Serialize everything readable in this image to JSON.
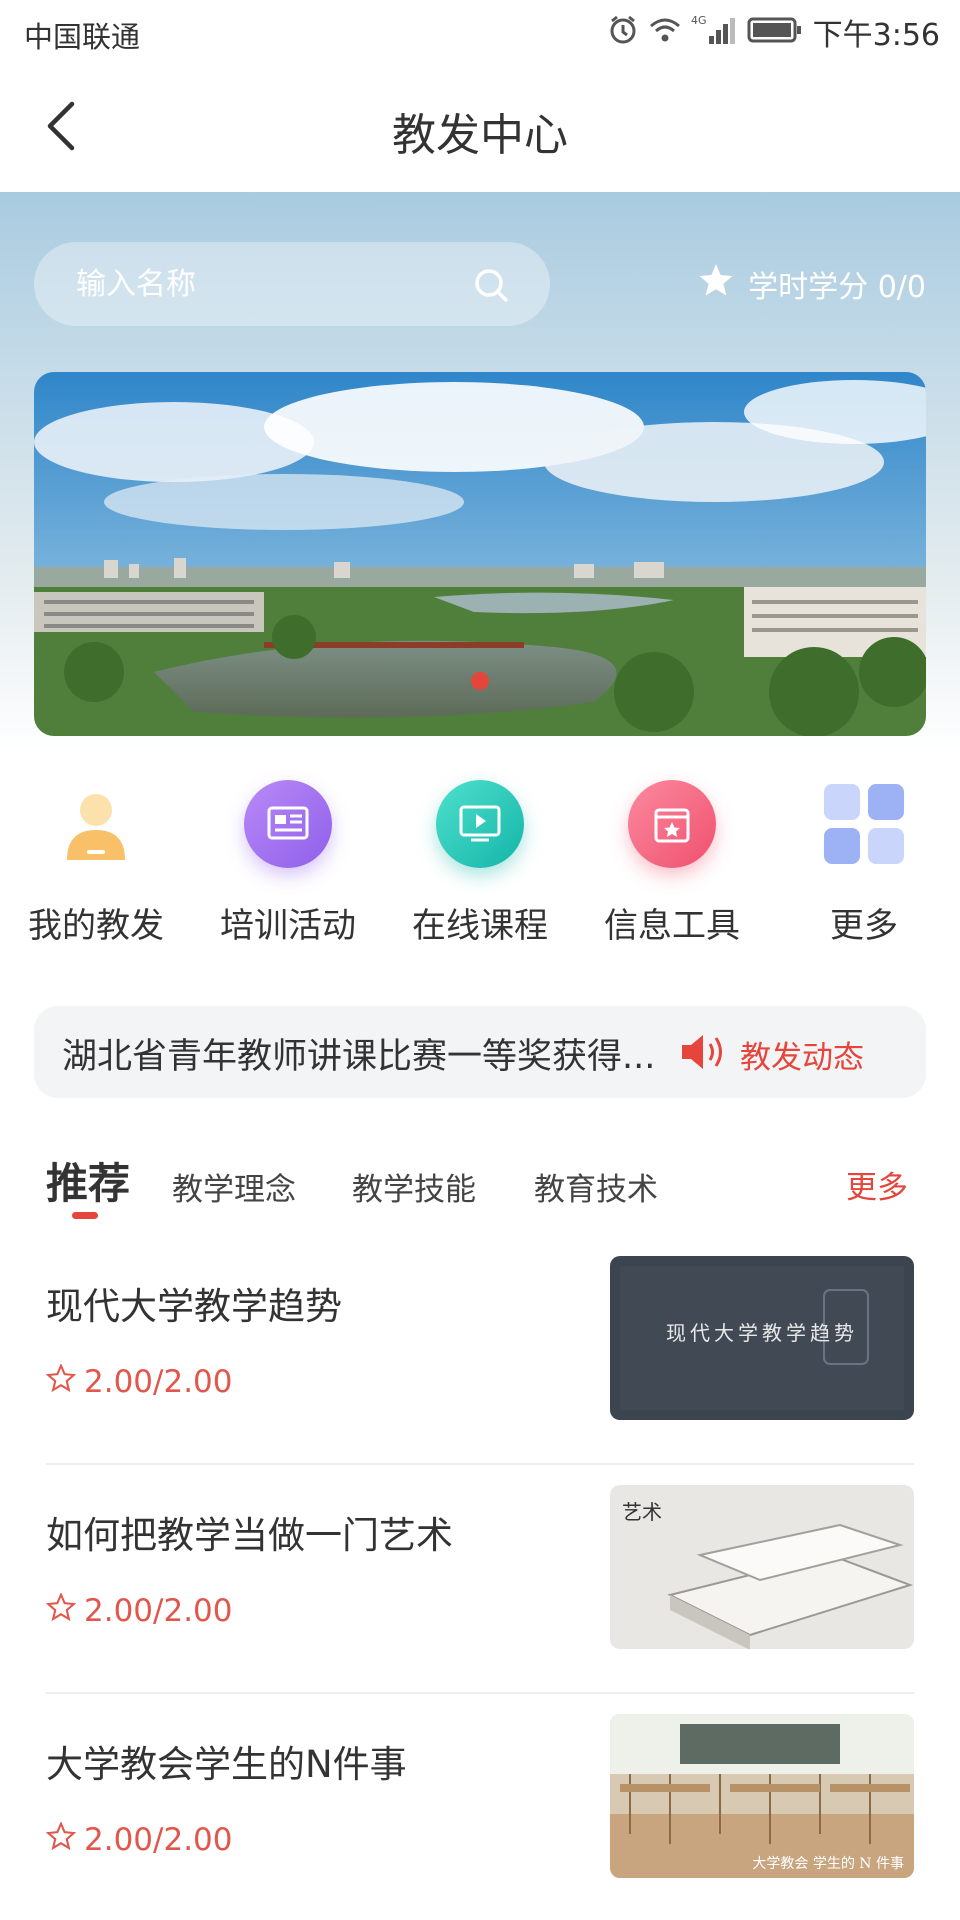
{
  "status_bar": {
    "carrier": "中国联通",
    "network": "4G",
    "time": "下午3:56"
  },
  "header": {
    "title": "教发中心"
  },
  "search": {
    "placeholder": "输入名称"
  },
  "credit": {
    "label": "学时学分 0/0"
  },
  "banner": {
    "slide_count": 1,
    "active_slide": 1
  },
  "menu": {
    "items": [
      {
        "label": "我的教发",
        "icon": "person-icon",
        "color": "#f9c06a"
      },
      {
        "label": "培训活动",
        "icon": "document-icon",
        "color": "#9f72f0"
      },
      {
        "label": "在线课程",
        "icon": "play-icon",
        "color": "#2ec9b8"
      },
      {
        "label": "信息工具",
        "icon": "toolbox-icon",
        "color": "#f5617a"
      },
      {
        "label": "更多",
        "icon": "grid-icon",
        "color": "#8ea6f3"
      }
    ]
  },
  "news": {
    "text": "湖北省青年教师讲课比赛一等奖获得...",
    "tag": "教发动态"
  },
  "tabs": {
    "items": [
      "推荐",
      "教学理念",
      "教学技能",
      "教育技术"
    ],
    "active": "推荐",
    "more": "更多"
  },
  "courses": [
    {
      "title": "现代大学教学趋势",
      "score": "2.00/2.00",
      "thumb_text": "现代大学教学趋势"
    },
    {
      "title": "如何把教学当做一门艺术",
      "score": "2.00/2.00",
      "thumb_text": "艺术"
    },
    {
      "title": "大学教会学生的N件事",
      "score": "2.00/2.00",
      "thumb_text": "大学教会 学生的 N 件事"
    }
  ],
  "colors": {
    "accent": "#e5453a",
    "text": "#333333"
  }
}
